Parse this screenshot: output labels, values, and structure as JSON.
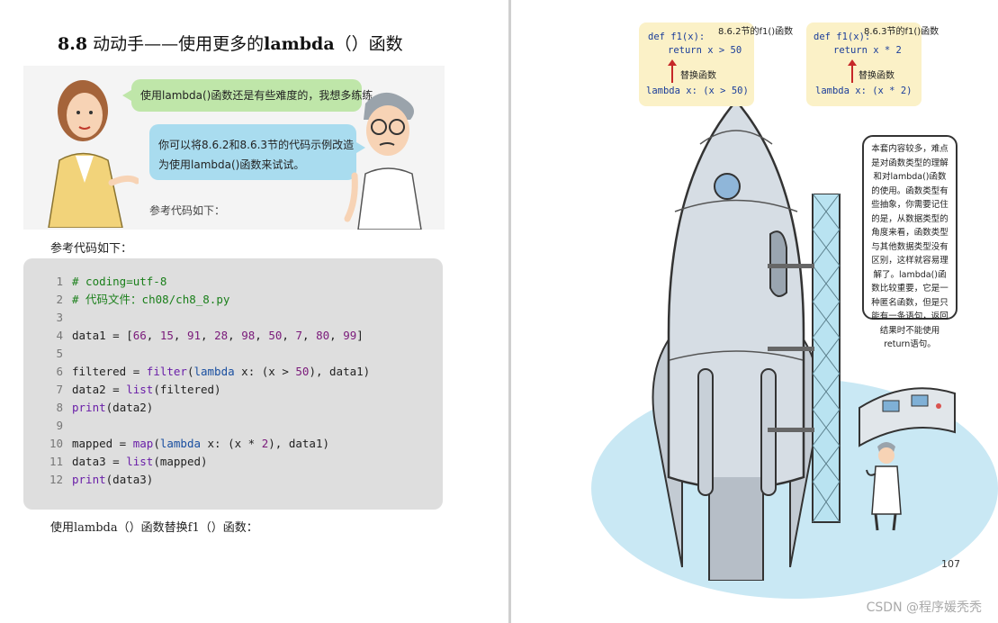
{
  "left_page": {
    "heading_bold_a": "8.8",
    "heading_text_a": " 动动手——使用更多的",
    "heading_bold_b": "lambda",
    "heading_text_b": "（）函数",
    "comic": {
      "bubble_1": "使用lambda()函数还是有些难度的，我想多练练。",
      "bubble_2_line_1": "你可以将8.6.2和8.6.3节的代码示例改造",
      "bubble_2_line_2": "为使用lambda()函数来试试。",
      "caption": "参考代码如下："
    },
    "paragraph_1": "参考代码如下：",
    "code_lines": [
      "1",
      "2",
      "3",
      "4",
      "5",
      "6",
      "7",
      "8",
      "9",
      "10",
      "11",
      "12"
    ],
    "code": {
      "l1": "# coding=utf-8",
      "l2": "# 代码文件：ch08/ch8_8.py",
      "l4_a": "data1 = [",
      "l4_nums": [
        "66",
        "15",
        "91",
        "28",
        "98",
        "50",
        "7",
        "80",
        "99"
      ],
      "l4_sep": ", ",
      "l4_b": "]",
      "l6_a": "filtered = ",
      "l6_fn": "filter",
      "l6_b": "(",
      "l6_kw": "lambda",
      "l6_c": " x: (x > ",
      "l6_num": "50",
      "l6_d": "), data1)",
      "l7_a": "data2 = ",
      "l7_fn": "list",
      "l7_b": "(filtered)",
      "l8_fn": "print",
      "l8_b": "(data2)",
      "l10_a": "mapped  = ",
      "l10_fn": "map",
      "l10_b": "(",
      "l10_kw": "lambda",
      "l10_c": " x: (x * ",
      "l10_num": "2",
      "l10_d": "), data1)",
      "l11_a": "data3 = ",
      "l11_fn": "list",
      "l11_b": "(mapped)",
      "l12_fn": "print",
      "l12_b": "(data3)"
    },
    "paragraph_2": "使用lambda（）函数替换f1（）函数："
  },
  "right_page": {
    "note_1": {
      "def": "def f1(x):",
      "ret": "return x > 50",
      "label": "8.6.2节的f1()函数",
      "replace": "替换函数",
      "lambda": "lambda x: (x > 50)"
    },
    "note_2": {
      "def": "def f1(x):",
      "ret": "return x * 2",
      "label": "8.6.3节的f1()函数",
      "replace": "替换函数",
      "lambda": "lambda x: (x * 2)"
    },
    "callout": "本套内容较多，难点是对函数类型的理解和对lambda()函数的使用。函数类型有些抽象，你需要记住的是，从数据类型的角度来看，函数类型与其他数据类型没有区别，这样就容易理解了。lambda()函数比较重要，它是一种匿名函数，但是只能有一条语句，返回结果时不能使用return语句。",
    "page_number": "107"
  },
  "watermark": "CSDN @程序媛秃秃",
  "colors": {
    "code_bg": "#dedede",
    "comment": "#1a7f1a",
    "keyword": "#1a4fa0",
    "number": "#7a1a7a",
    "note_bg": "#fbf1c7",
    "arrow": "#c62828",
    "ground": "#c9e8f4"
  }
}
